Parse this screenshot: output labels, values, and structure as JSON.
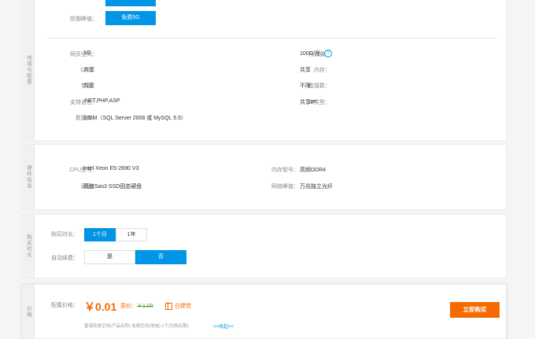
{
  "region": {
    "side_label": "地域与配置",
    "top_btn": "",
    "ddos_label": "防御峰值：",
    "ddos_value": "免费5G",
    "specs": [
      {
        "label": "网页空间：",
        "value": "1G"
      },
      {
        "label": "月流量：",
        "value": "100G/月"
      },
      {
        "label": "CPU：",
        "value": "共享"
      },
      {
        "label": "内存：",
        "value": "共享"
      },
      {
        "label": "带宽：",
        "value": "共享"
      },
      {
        "label": "连接数：",
        "value": "不限"
      },
      {
        "label": "支持语言：",
        "value": ".NET,PHP,ASP"
      },
      {
        "label": "IP类型：",
        "value": "共享IP"
      },
      {
        "label": "数据库：",
        "value": "100M（SQL Server 2008 或 MySQL 5.5）"
      }
    ],
    "help_icon": "?"
  },
  "hardware": {
    "side_label": "硬件信息",
    "specs": [
      {
        "label": "CPU型号：",
        "value": "Intel Xeon E5-2690 V3"
      },
      {
        "label": "内存型号：",
        "value": "高频DDR4"
      },
      {
        "label": "磁盘：",
        "value": "高速Sas3 SSD固态硬盘"
      },
      {
        "label": "网络峰值：",
        "value": "万兆独立光纤"
      }
    ]
  },
  "purchase": {
    "side_label": "购买时长",
    "duration_label": "购买时长：",
    "duration_options": [
      "1个月",
      "1年"
    ],
    "renew_label": "自动续费：",
    "renew_options": [
      "是",
      "否"
    ]
  },
  "price": {
    "side_label": "价格",
    "config_label": "配置价格：",
    "amount": "￥0.01",
    "original_label": "原价：",
    "original": "￥1.00",
    "gift": "白嫖党",
    "summary": "香港免费空间(产品名称) 免费空间(地域) 1个月(购买期)",
    "collapse": ">>收起<<",
    "buy_button": "立即购买"
  },
  "colors": {
    "accent": "#0095e5",
    "orange": "#f56a00"
  }
}
